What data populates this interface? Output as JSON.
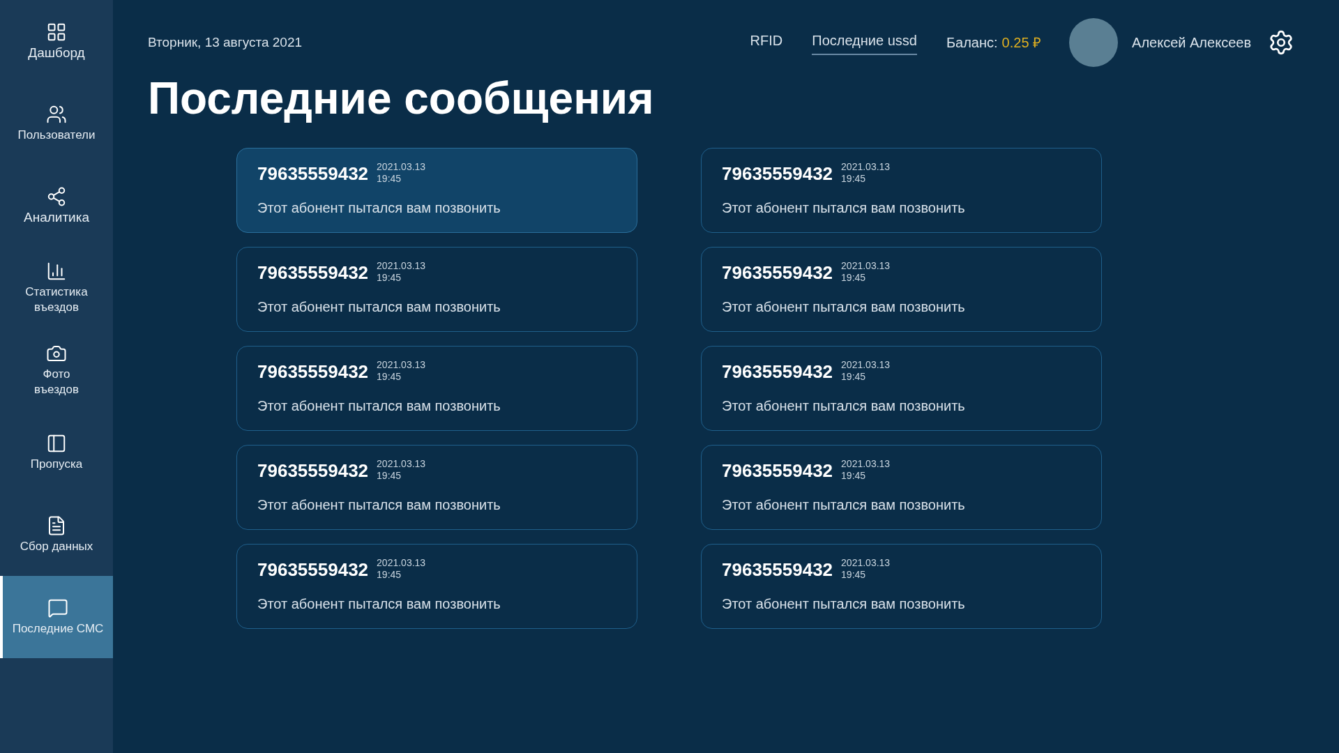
{
  "sidebar": {
    "items": [
      {
        "label": "Дашборд",
        "selected": false
      },
      {
        "label": "Пользователи",
        "selected": false
      },
      {
        "label": "Аналитика",
        "selected": false
      },
      {
        "label": "Статистика въездов",
        "selected": false
      },
      {
        "label": "Фото въездов",
        "selected": false
      },
      {
        "label": "Пропуска",
        "selected": false
      },
      {
        "label": "Сбор данных",
        "selected": false
      },
      {
        "label": "Последние СМС",
        "selected": true
      }
    ]
  },
  "header": {
    "date": "Вторник, 13 августа 2021",
    "nav": [
      {
        "label": "RFID",
        "selected": false
      },
      {
        "label": "Последние ussd",
        "selected": true
      }
    ],
    "balance_label": "Баланс:",
    "balance_value": "0.25 ₽",
    "user_name": "Алексей Алексеев"
  },
  "title": "Последние сообщения",
  "messages": [
    {
      "phone": "79635559432",
      "date": "2021.03.13",
      "time": "19:45",
      "text": "Этот абонент пытался вам позвонить",
      "selected": true
    },
    {
      "phone": "79635559432",
      "date": "2021.03.13",
      "time": "19:45",
      "text": "Этот абонент пытался вам позвонить",
      "selected": false
    },
    {
      "phone": "79635559432",
      "date": "2021.03.13",
      "time": "19:45",
      "text": "Этот абонент пытался вам позвонить",
      "selected": false
    },
    {
      "phone": "79635559432",
      "date": "2021.03.13",
      "time": "19:45",
      "text": "Этот абонент пытался вам позвонить",
      "selected": false
    },
    {
      "phone": "79635559432",
      "date": "2021.03.13",
      "time": "19:45",
      "text": "Этот абонент пытался вам позвонить",
      "selected": false
    },
    {
      "phone": "79635559432",
      "date": "2021.03.13",
      "time": "19:45",
      "text": "Этот абонент пытался вам позвонить",
      "selected": false
    },
    {
      "phone": "79635559432",
      "date": "2021.03.13",
      "time": "19:45",
      "text": "Этот абонент пытался вам позвонить",
      "selected": false
    },
    {
      "phone": "79635559432",
      "date": "2021.03.13",
      "time": "19:45",
      "text": "Этот абонент пытался вам позвонить",
      "selected": false
    },
    {
      "phone": "79635559432",
      "date": "2021.03.13",
      "time": "19:45",
      "text": "Этот абонент пытался вам позвонить",
      "selected": false
    },
    {
      "phone": "79635559432",
      "date": "2021.03.13",
      "time": "19:45",
      "text": "Этот абонент пытался вам позвонить",
      "selected": false
    }
  ]
}
